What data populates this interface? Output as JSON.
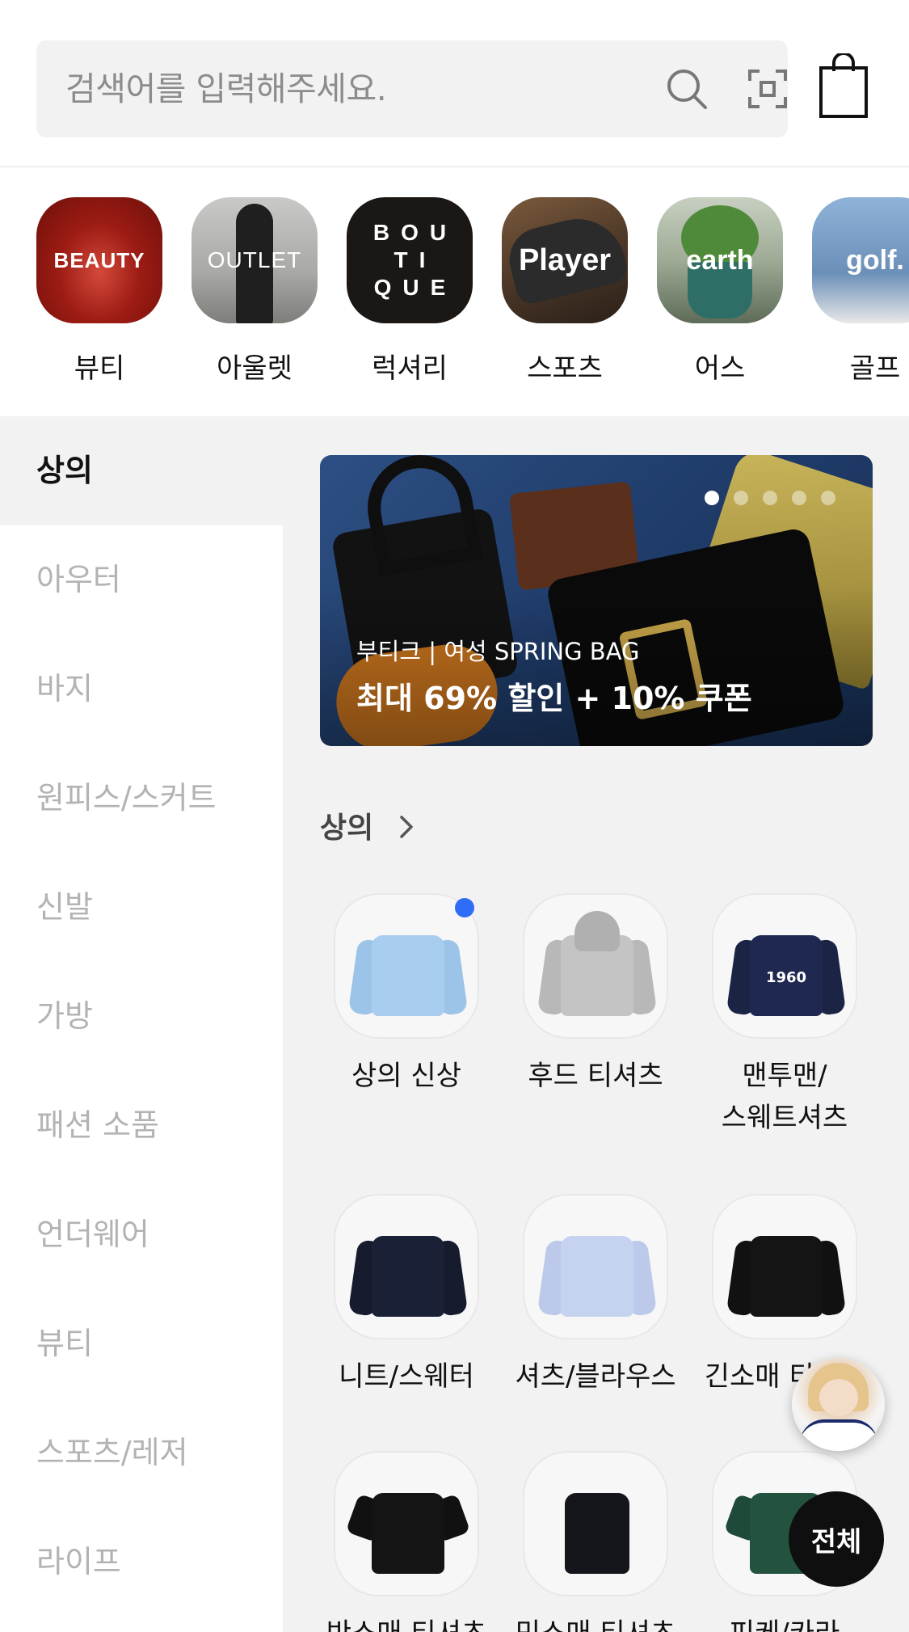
{
  "search": {
    "placeholder": "검색어를 입력해주세요."
  },
  "brands": [
    {
      "label": "뷰티",
      "thumb_text": "BEAUTY"
    },
    {
      "label": "아울렛",
      "thumb_text": "OUTLET"
    },
    {
      "label": "럭셔리",
      "thumb_text": "BOU TI QUE"
    },
    {
      "label": "스포츠",
      "thumb_text": "Player"
    },
    {
      "label": "어스",
      "thumb_text": "earth"
    },
    {
      "label": "골프",
      "thumb_text": "golf."
    }
  ],
  "sidebar": {
    "items": [
      {
        "label": "상의",
        "active": true
      },
      {
        "label": "아우터"
      },
      {
        "label": "바지"
      },
      {
        "label": "원피스/스커트"
      },
      {
        "label": "신발"
      },
      {
        "label": "가방"
      },
      {
        "label": "패션 소품"
      },
      {
        "label": "언더웨어"
      },
      {
        "label": "뷰티"
      },
      {
        "label": "스포츠/레저"
      },
      {
        "label": "라이프"
      }
    ]
  },
  "banner": {
    "subtitle": "부티크 | 여성 SPRING BAG",
    "title": "최대 69% 할인 + 10% 쿠폰",
    "page_count": 5,
    "current_page": 1
  },
  "section": {
    "title": "상의"
  },
  "categories": [
    {
      "label": "상의 신상",
      "is_new": true,
      "print": ""
    },
    {
      "label": "후드 티셔츠",
      "print": ""
    },
    {
      "label": "맨투맨/\n스웨트셔츠",
      "print": "1960"
    },
    {
      "label": "니트/스웨터",
      "print": ""
    },
    {
      "label": "셔츠/블라우스",
      "print": ""
    },
    {
      "label": "긴소매 티셔츠",
      "print": ""
    },
    {
      "label": "반소매 티셔츠",
      "print": ""
    },
    {
      "label": "민소매 티셔츠",
      "print": ""
    },
    {
      "label": "피케/카라",
      "print": ""
    }
  ],
  "floating": {
    "all_button": "전체"
  },
  "colors": {
    "accent_dot": "#2f6df6",
    "inactive_text": "#b3b3b3",
    "panel_bg": "#f2f2f2"
  },
  "icons": [
    "search-icon",
    "scan-icon",
    "shopping-bag-icon",
    "chevron-right-icon"
  ]
}
